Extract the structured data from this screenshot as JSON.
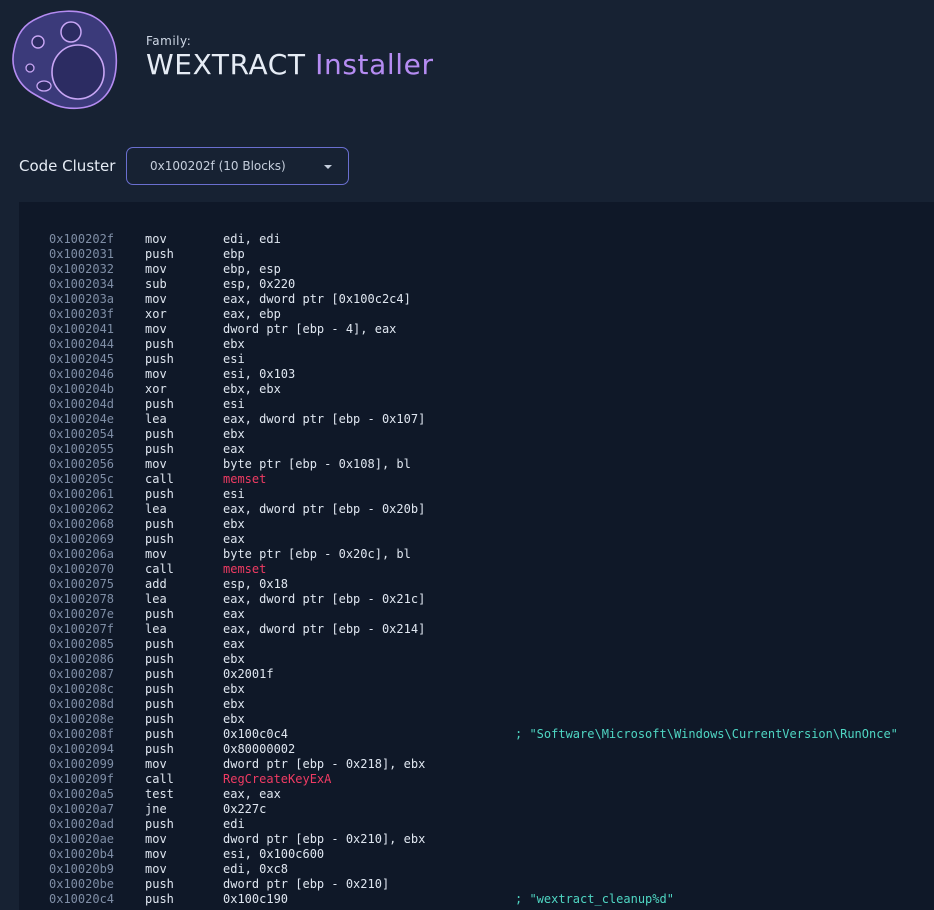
{
  "header": {
    "family_label": "Family:",
    "family_name": "WEXTRACT",
    "family_type": "Installer",
    "logo_icon": "planet-icon",
    "colors": {
      "background": "#172233",
      "accent": "#b58cf2",
      "panel": "#0f1828",
      "call_target": "#ef3b63",
      "comment": "#4fd6c3"
    }
  },
  "cluster": {
    "label": "Code Cluster",
    "selected": "0x100202f (10 Blocks)"
  },
  "code": {
    "lines": [
      {
        "addr": "0x100202f",
        "mnemonic": "mov",
        "operands": "edi, edi",
        "is_call": false,
        "comment": ""
      },
      {
        "addr": "0x1002031",
        "mnemonic": "push",
        "operands": "ebp",
        "is_call": false,
        "comment": ""
      },
      {
        "addr": "0x1002032",
        "mnemonic": "mov",
        "operands": "ebp, esp",
        "is_call": false,
        "comment": ""
      },
      {
        "addr": "0x1002034",
        "mnemonic": "sub",
        "operands": "esp, 0x220",
        "is_call": false,
        "comment": ""
      },
      {
        "addr": "0x100203a",
        "mnemonic": "mov",
        "operands": "eax, dword ptr [0x100c2c4]",
        "is_call": false,
        "comment": ""
      },
      {
        "addr": "0x100203f",
        "mnemonic": "xor",
        "operands": "eax, ebp",
        "is_call": false,
        "comment": ""
      },
      {
        "addr": "0x1002041",
        "mnemonic": "mov",
        "operands": "dword ptr [ebp - 4], eax",
        "is_call": false,
        "comment": ""
      },
      {
        "addr": "0x1002044",
        "mnemonic": "push",
        "operands": "ebx",
        "is_call": false,
        "comment": ""
      },
      {
        "addr": "0x1002045",
        "mnemonic": "push",
        "operands": "esi",
        "is_call": false,
        "comment": ""
      },
      {
        "addr": "0x1002046",
        "mnemonic": "mov",
        "operands": "esi, 0x103",
        "is_call": false,
        "comment": ""
      },
      {
        "addr": "0x100204b",
        "mnemonic": "xor",
        "operands": "ebx, ebx",
        "is_call": false,
        "comment": ""
      },
      {
        "addr": "0x100204d",
        "mnemonic": "push",
        "operands": "esi",
        "is_call": false,
        "comment": ""
      },
      {
        "addr": "0x100204e",
        "mnemonic": "lea",
        "operands": "eax, dword ptr [ebp - 0x107]",
        "is_call": false,
        "comment": ""
      },
      {
        "addr": "0x1002054",
        "mnemonic": "push",
        "operands": "ebx",
        "is_call": false,
        "comment": ""
      },
      {
        "addr": "0x1002055",
        "mnemonic": "push",
        "operands": "eax",
        "is_call": false,
        "comment": ""
      },
      {
        "addr": "0x1002056",
        "mnemonic": "mov",
        "operands": "byte ptr [ebp - 0x108], bl",
        "is_call": false,
        "comment": ""
      },
      {
        "addr": "0x100205c",
        "mnemonic": "call",
        "operands": "memset",
        "is_call": true,
        "comment": ""
      },
      {
        "addr": "0x1002061",
        "mnemonic": "push",
        "operands": "esi",
        "is_call": false,
        "comment": ""
      },
      {
        "addr": "0x1002062",
        "mnemonic": "lea",
        "operands": "eax, dword ptr [ebp - 0x20b]",
        "is_call": false,
        "comment": ""
      },
      {
        "addr": "0x1002068",
        "mnemonic": "push",
        "operands": "ebx",
        "is_call": false,
        "comment": ""
      },
      {
        "addr": "0x1002069",
        "mnemonic": "push",
        "operands": "eax",
        "is_call": false,
        "comment": ""
      },
      {
        "addr": "0x100206a",
        "mnemonic": "mov",
        "operands": "byte ptr [ebp - 0x20c], bl",
        "is_call": false,
        "comment": ""
      },
      {
        "addr": "0x1002070",
        "mnemonic": "call",
        "operands": "memset",
        "is_call": true,
        "comment": ""
      },
      {
        "addr": "0x1002075",
        "mnemonic": "add",
        "operands": "esp, 0x18",
        "is_call": false,
        "comment": ""
      },
      {
        "addr": "0x1002078",
        "mnemonic": "lea",
        "operands": "eax, dword ptr [ebp - 0x21c]",
        "is_call": false,
        "comment": ""
      },
      {
        "addr": "0x100207e",
        "mnemonic": "push",
        "operands": "eax",
        "is_call": false,
        "comment": ""
      },
      {
        "addr": "0x100207f",
        "mnemonic": "lea",
        "operands": "eax, dword ptr [ebp - 0x214]",
        "is_call": false,
        "comment": ""
      },
      {
        "addr": "0x1002085",
        "mnemonic": "push",
        "operands": "eax",
        "is_call": false,
        "comment": ""
      },
      {
        "addr": "0x1002086",
        "mnemonic": "push",
        "operands": "ebx",
        "is_call": false,
        "comment": ""
      },
      {
        "addr": "0x1002087",
        "mnemonic": "push",
        "operands": "0x2001f",
        "is_call": false,
        "comment": ""
      },
      {
        "addr": "0x100208c",
        "mnemonic": "push",
        "operands": "ebx",
        "is_call": false,
        "comment": ""
      },
      {
        "addr": "0x100208d",
        "mnemonic": "push",
        "operands": "ebx",
        "is_call": false,
        "comment": ""
      },
      {
        "addr": "0x100208e",
        "mnemonic": "push",
        "operands": "ebx",
        "is_call": false,
        "comment": ""
      },
      {
        "addr": "0x100208f",
        "mnemonic": "push",
        "operands": "0x100c0c4",
        "is_call": false,
        "comment": "; \"Software\\Microsoft\\Windows\\CurrentVersion\\RunOnce\""
      },
      {
        "addr": "0x1002094",
        "mnemonic": "push",
        "operands": "0x80000002",
        "is_call": false,
        "comment": ""
      },
      {
        "addr": "0x1002099",
        "mnemonic": "mov",
        "operands": "dword ptr [ebp - 0x218], ebx",
        "is_call": false,
        "comment": ""
      },
      {
        "addr": "0x100209f",
        "mnemonic": "call",
        "operands": "RegCreateKeyExA",
        "is_call": true,
        "comment": ""
      },
      {
        "addr": "0x10020a5",
        "mnemonic": "test",
        "operands": "eax, eax",
        "is_call": false,
        "comment": ""
      },
      {
        "addr": "0x10020a7",
        "mnemonic": "jne",
        "operands": "0x227c",
        "is_call": false,
        "comment": ""
      },
      {
        "addr": "0x10020ad",
        "mnemonic": "push",
        "operands": "edi",
        "is_call": false,
        "comment": ""
      },
      {
        "addr": "0x10020ae",
        "mnemonic": "mov",
        "operands": "dword ptr [ebp - 0x210], ebx",
        "is_call": false,
        "comment": ""
      },
      {
        "addr": "0x10020b4",
        "mnemonic": "mov",
        "operands": "esi, 0x100c600",
        "is_call": false,
        "comment": ""
      },
      {
        "addr": "0x10020b9",
        "mnemonic": "mov",
        "operands": "edi, 0xc8",
        "is_call": false,
        "comment": ""
      },
      {
        "addr": "0x10020be",
        "mnemonic": "push",
        "operands": "dword ptr [ebp - 0x210]",
        "is_call": false,
        "comment": ""
      },
      {
        "addr": "0x10020c4",
        "mnemonic": "push",
        "operands": "0x100c190",
        "is_call": false,
        "comment": "; \"wextract_cleanup%d\""
      }
    ]
  }
}
